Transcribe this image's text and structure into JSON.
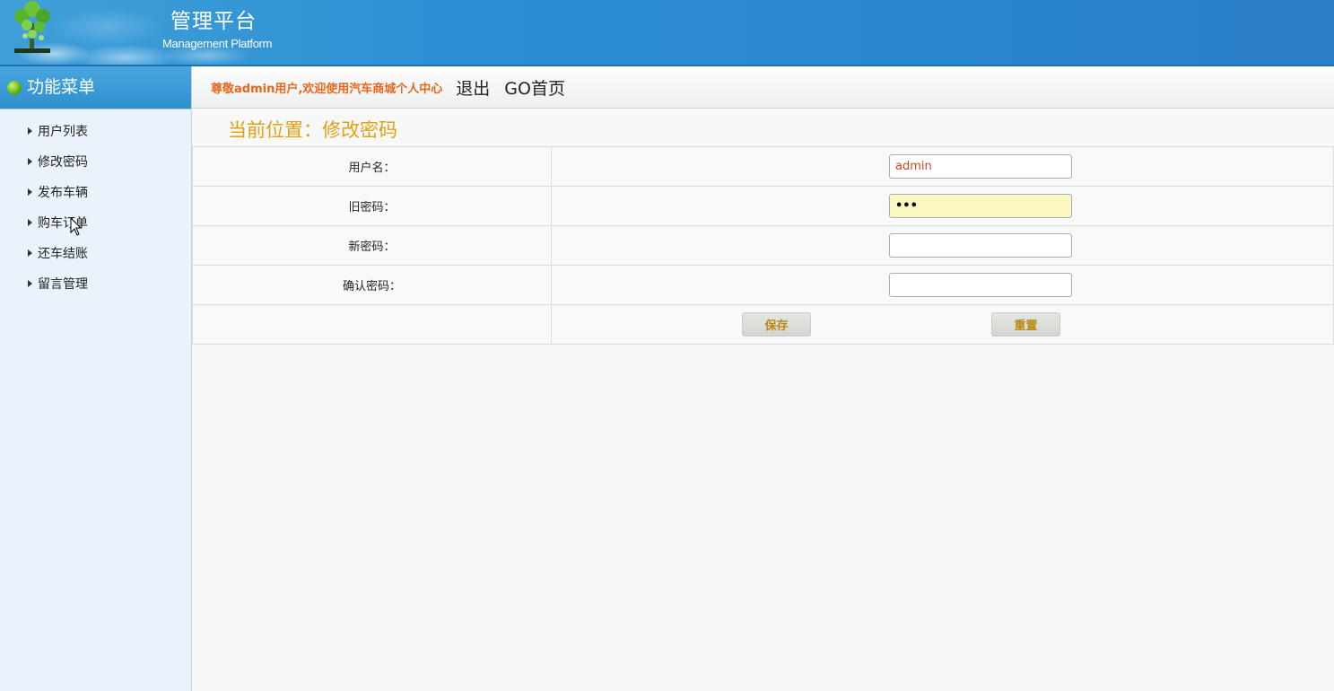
{
  "header": {
    "title": "管理平台",
    "subtitle": "Management Platform"
  },
  "sidebar": {
    "title": "功能菜单",
    "items": [
      {
        "label": "用户列表"
      },
      {
        "label": "修改密码"
      },
      {
        "label": "发布车辆"
      },
      {
        "label": "购车订单"
      },
      {
        "label": "还车结账"
      },
      {
        "label": "留言管理"
      }
    ]
  },
  "topbar": {
    "welcome": "尊敬admin用户,欢迎使用汽车商城个人中心",
    "logout": "退出",
    "home": "GO首页"
  },
  "location": "当前位置：修改密码",
  "form": {
    "username_label": "用户名：",
    "username_value": "admin",
    "old_password_label": "旧密码：",
    "old_password_value": "•••",
    "new_password_label": "新密码：",
    "confirm_password_label": "确认密码：",
    "save_label": "保存",
    "reset_label": "重置"
  },
  "colors": {
    "header_blue": "#2d8fd3",
    "welcome_orange": "#e8661b",
    "location_gold": "#e3a013",
    "autofill_yellow": "#fbf8c2"
  }
}
